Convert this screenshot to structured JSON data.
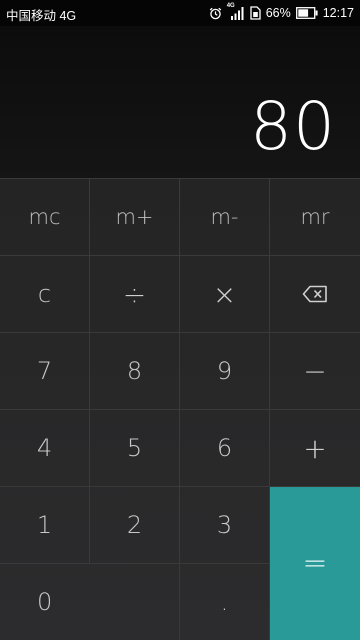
{
  "status_bar": {
    "carrier": "中国移动 4G",
    "network_badge": "4G",
    "battery_percent": "66%",
    "battery_level": 0.66,
    "time": "12:17",
    "icons": [
      "alarm-icon",
      "signal-icon",
      "sim-icon",
      "battery-icon"
    ]
  },
  "display": {
    "result": "80"
  },
  "keypad": {
    "memory": {
      "mc": "mc",
      "m_plus": "m+",
      "m_minus": "m-",
      "mr": "mr"
    },
    "clear": "c",
    "divide": "÷",
    "multiply": "×",
    "backspace_icon": "backspace-icon",
    "subtract": "−",
    "add": "+",
    "equals": "=",
    "decimal": ".",
    "digits": {
      "d0": "0",
      "d1": "1",
      "d2": "2",
      "d3": "3",
      "d4": "4",
      "d5": "5",
      "d6": "6",
      "d7": "7",
      "d8": "8",
      "d9": "9"
    }
  },
  "colors": {
    "equals_bg": "#2a9a99",
    "keypad_bg": "#262628",
    "display_bg": "#101010",
    "key_text": "#c8c8c8"
  }
}
